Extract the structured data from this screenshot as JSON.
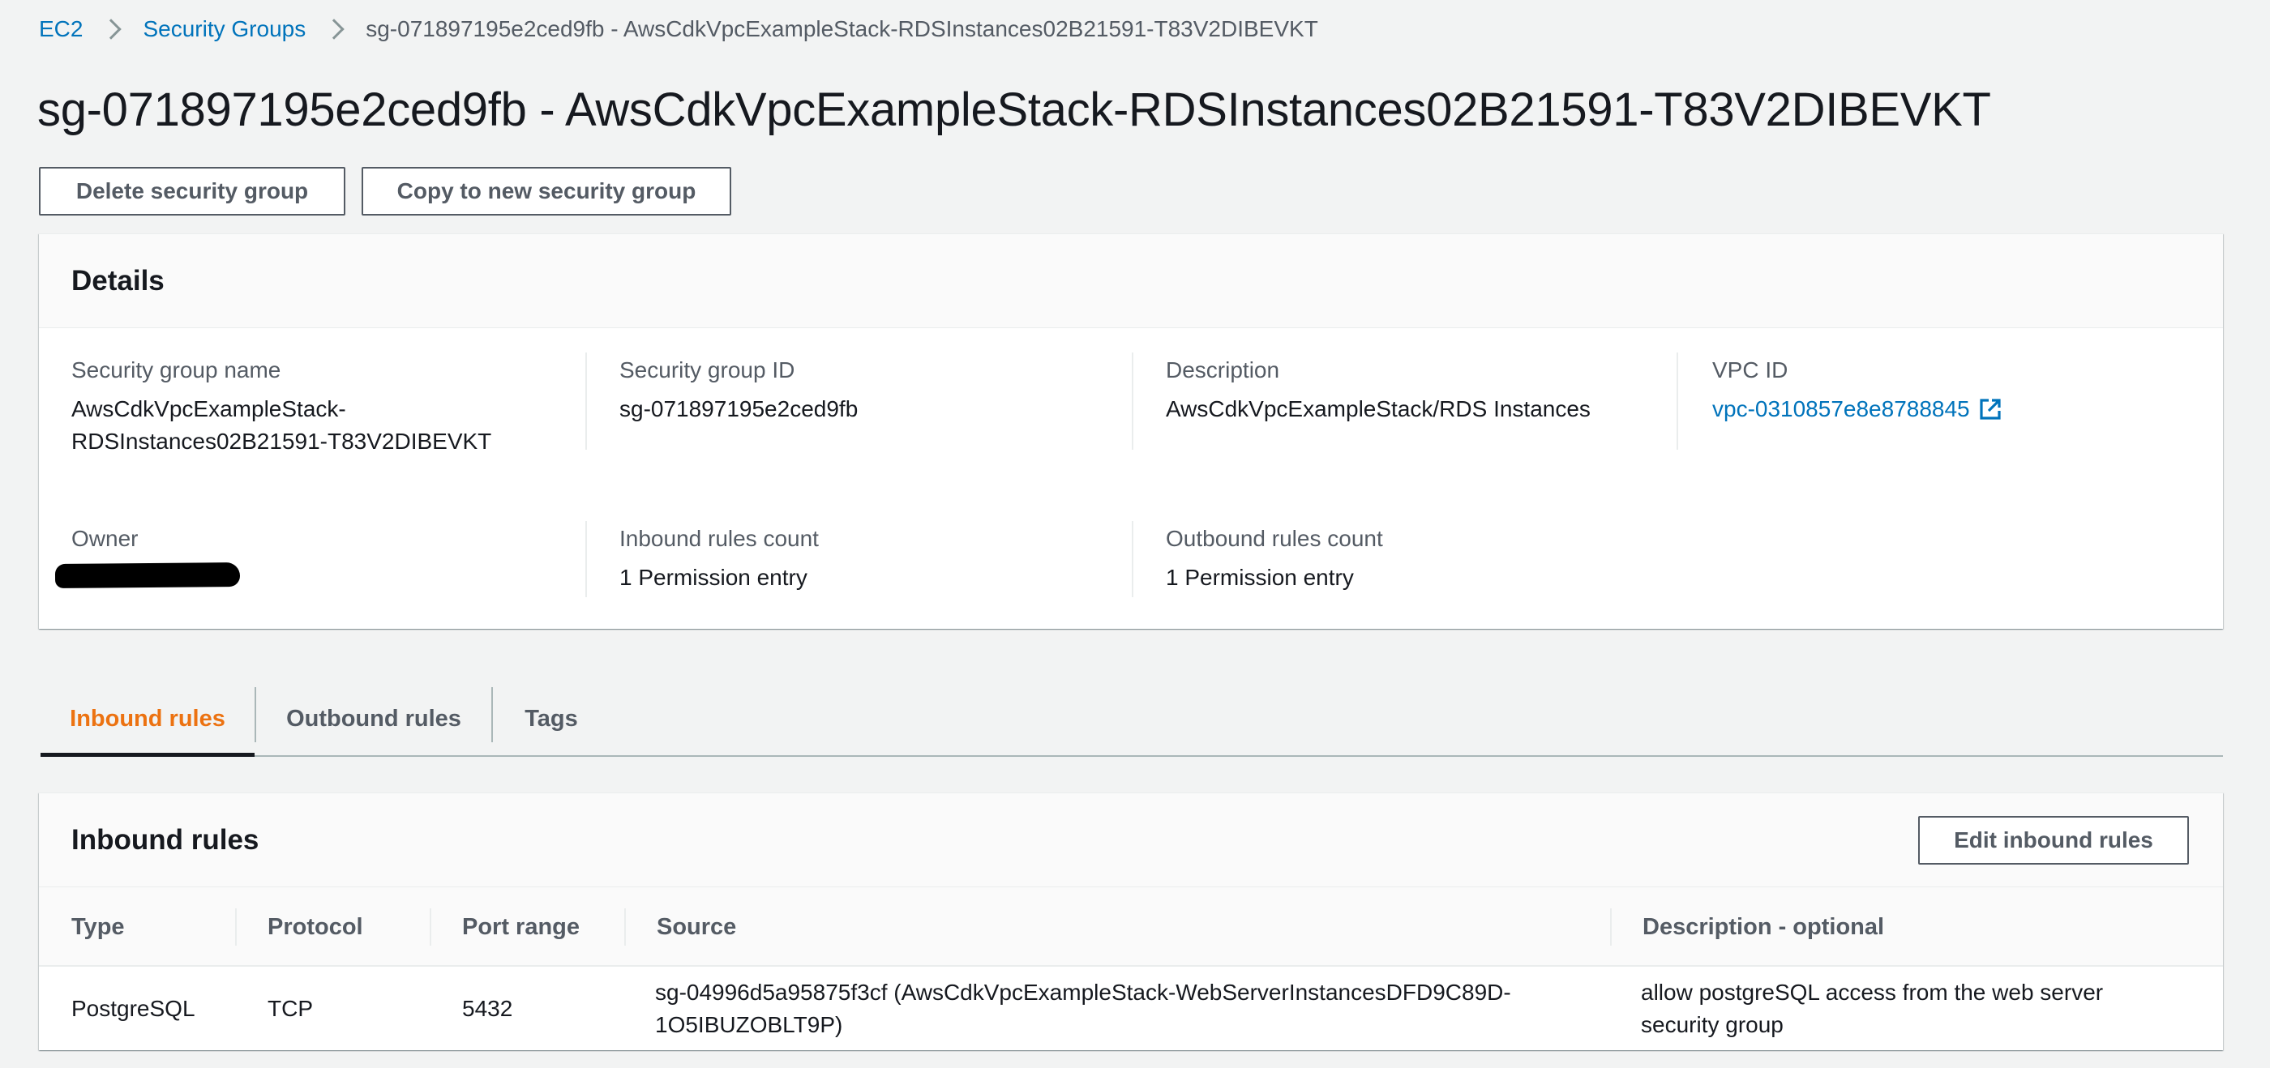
{
  "breadcrumb": {
    "items": [
      "EC2",
      "Security Groups"
    ],
    "current": "sg-071897195e2ced9fb - AwsCdkVpcExampleStack-RDSInstances02B21591-T83V2DIBEVKT"
  },
  "page_title": "sg-071897195e2ced9fb - AwsCdkVpcExampleStack-RDSInstances02B21591-T83V2DIBEVKT",
  "actions": {
    "delete_label": "Delete security group",
    "copy_label": "Copy to new security group"
  },
  "details": {
    "title": "Details",
    "security_group_name": {
      "label": "Security group name",
      "line1": "AwsCdkVpcExampleStack-",
      "line2": "RDSInstances02B21591-T83V2DIBEVKT"
    },
    "security_group_id": {
      "label": "Security group ID",
      "value": "sg-071897195e2ced9fb"
    },
    "description": {
      "label": "Description",
      "value": "AwsCdkVpcExampleStack/RDS Instances"
    },
    "vpc_id": {
      "label": "VPC ID",
      "value": "vpc-0310857e8e8788845",
      "icon": "external-link-icon"
    },
    "owner": {
      "label": "Owner",
      "value": ""
    },
    "inbound_count": {
      "label": "Inbound rules count",
      "value": "1 Permission entry"
    },
    "outbound_count": {
      "label": "Outbound rules count",
      "value": "1 Permission entry"
    }
  },
  "tabs": [
    {
      "label": "Inbound rules",
      "active": true
    },
    {
      "label": "Outbound rules",
      "active": false
    },
    {
      "label": "Tags",
      "active": false
    }
  ],
  "inbound_rules": {
    "title": "Inbound rules",
    "edit_label": "Edit inbound rules",
    "columns": [
      "Type",
      "Protocol",
      "Port range",
      "Source",
      "Description - optional"
    ],
    "rows": [
      {
        "type": "PostgreSQL",
        "protocol": "TCP",
        "port_range": "5432",
        "source_line1": "sg-04996d5a95875f3cf (AwsCdkVpcExampleStack-WebServerInstancesDFD9C89D-",
        "source_line2": "1O5IBUZOBLT9P)",
        "description_line1": "allow postgreSQL access from the web server",
        "description_line2": "security group"
      }
    ]
  },
  "colors": {
    "link": "#0073bb",
    "active_tab": "#ec7211",
    "text": "#16191f",
    "secondary_text": "#545b64",
    "background": "#f2f3f3"
  }
}
